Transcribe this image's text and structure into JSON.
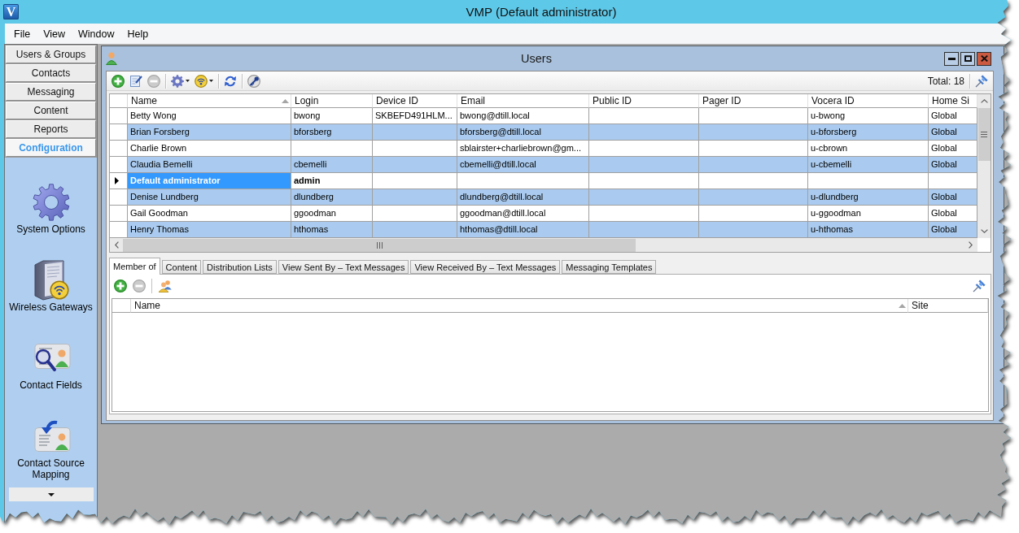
{
  "window": {
    "logo": "V",
    "title": "VMP (Default administrator)"
  },
  "menu": [
    "File",
    "View",
    "Window",
    "Help"
  ],
  "nav": [
    {
      "label": "Users & Groups",
      "selected": false
    },
    {
      "label": "Contacts",
      "selected": false
    },
    {
      "label": "Messaging",
      "selected": false
    },
    {
      "label": "Content",
      "selected": false
    },
    {
      "label": "Reports",
      "selected": false
    },
    {
      "label": "Configuration",
      "selected": true
    }
  ],
  "config_items": [
    {
      "label": "System Options",
      "kind": "gear"
    },
    {
      "label": "Wireless Gateways",
      "kind": "server"
    },
    {
      "label": "Contact Fields",
      "kind": "lookup"
    },
    {
      "label": "Contact Source Mapping",
      "kind": "import"
    }
  ],
  "users_window": {
    "title": "Users",
    "total": "Total: 18",
    "columns": [
      {
        "label": "Name",
        "sorted": true
      },
      {
        "label": "Login",
        "sorted": false
      },
      {
        "label": "Device ID",
        "sorted": false
      },
      {
        "label": "Email",
        "sorted": false
      },
      {
        "label": "Public ID",
        "sorted": false
      },
      {
        "label": "Pager ID",
        "sorted": false
      },
      {
        "label": "Vocera ID",
        "sorted": false
      },
      {
        "label": "Home Si",
        "sorted": false
      }
    ],
    "rows": [
      {
        "selected": false,
        "cells": [
          "Betty Wong",
          "bwong",
          "SKBEFD491HLM...",
          "bwong@dtill.local",
          null,
          null,
          "u-bwong",
          "Global"
        ]
      },
      {
        "selected": false,
        "cells": [
          "Brian Forsberg",
          "bforsberg",
          null,
          "bforsberg@dtill.local",
          null,
          null,
          "u-bforsberg",
          "Global"
        ]
      },
      {
        "selected": false,
        "cells": [
          "Charlie Brown",
          null,
          null,
          "sblairster+charliebrown@gm...",
          null,
          null,
          "u-cbrown",
          "Global"
        ]
      },
      {
        "selected": false,
        "cells": [
          "Claudia Bemelli",
          "cbemelli",
          null,
          "cbemelli@dtill.local",
          null,
          null,
          "u-cbemelli",
          "Global"
        ]
      },
      {
        "selected": true,
        "cells": [
          "Default administrator",
          "admin",
          null,
          null,
          null,
          null,
          null,
          null
        ]
      },
      {
        "selected": false,
        "cells": [
          "Denise Lundberg",
          "dlundberg",
          null,
          "dlundberg@dtill.local",
          null,
          null,
          "u-dlundberg",
          "Global"
        ]
      },
      {
        "selected": false,
        "cells": [
          "Gail Goodman",
          "ggoodman",
          null,
          "ggoodman@dtill.local",
          null,
          null,
          "u-ggoodman",
          "Global"
        ]
      },
      {
        "selected": false,
        "cells": [
          "Henry Thomas",
          "hthomas",
          null,
          "hthomas@dtill.local",
          null,
          null,
          "u-hthomas",
          "Global"
        ]
      }
    ]
  },
  "tabs": [
    {
      "label": "Member of",
      "selected": true
    },
    {
      "label": "Content",
      "selected": false
    },
    {
      "label": "Distribution Lists",
      "selected": false
    },
    {
      "label": "View Sent By – Text Messages",
      "selected": false
    },
    {
      "label": "View Received By – Text Messages",
      "selected": false
    },
    {
      "label": "Messaging Templates",
      "selected": false
    }
  ],
  "member_of": {
    "columns": [
      {
        "label": "Name",
        "sorted": true
      },
      {
        "label": "Site",
        "sorted": false
      }
    ]
  }
}
